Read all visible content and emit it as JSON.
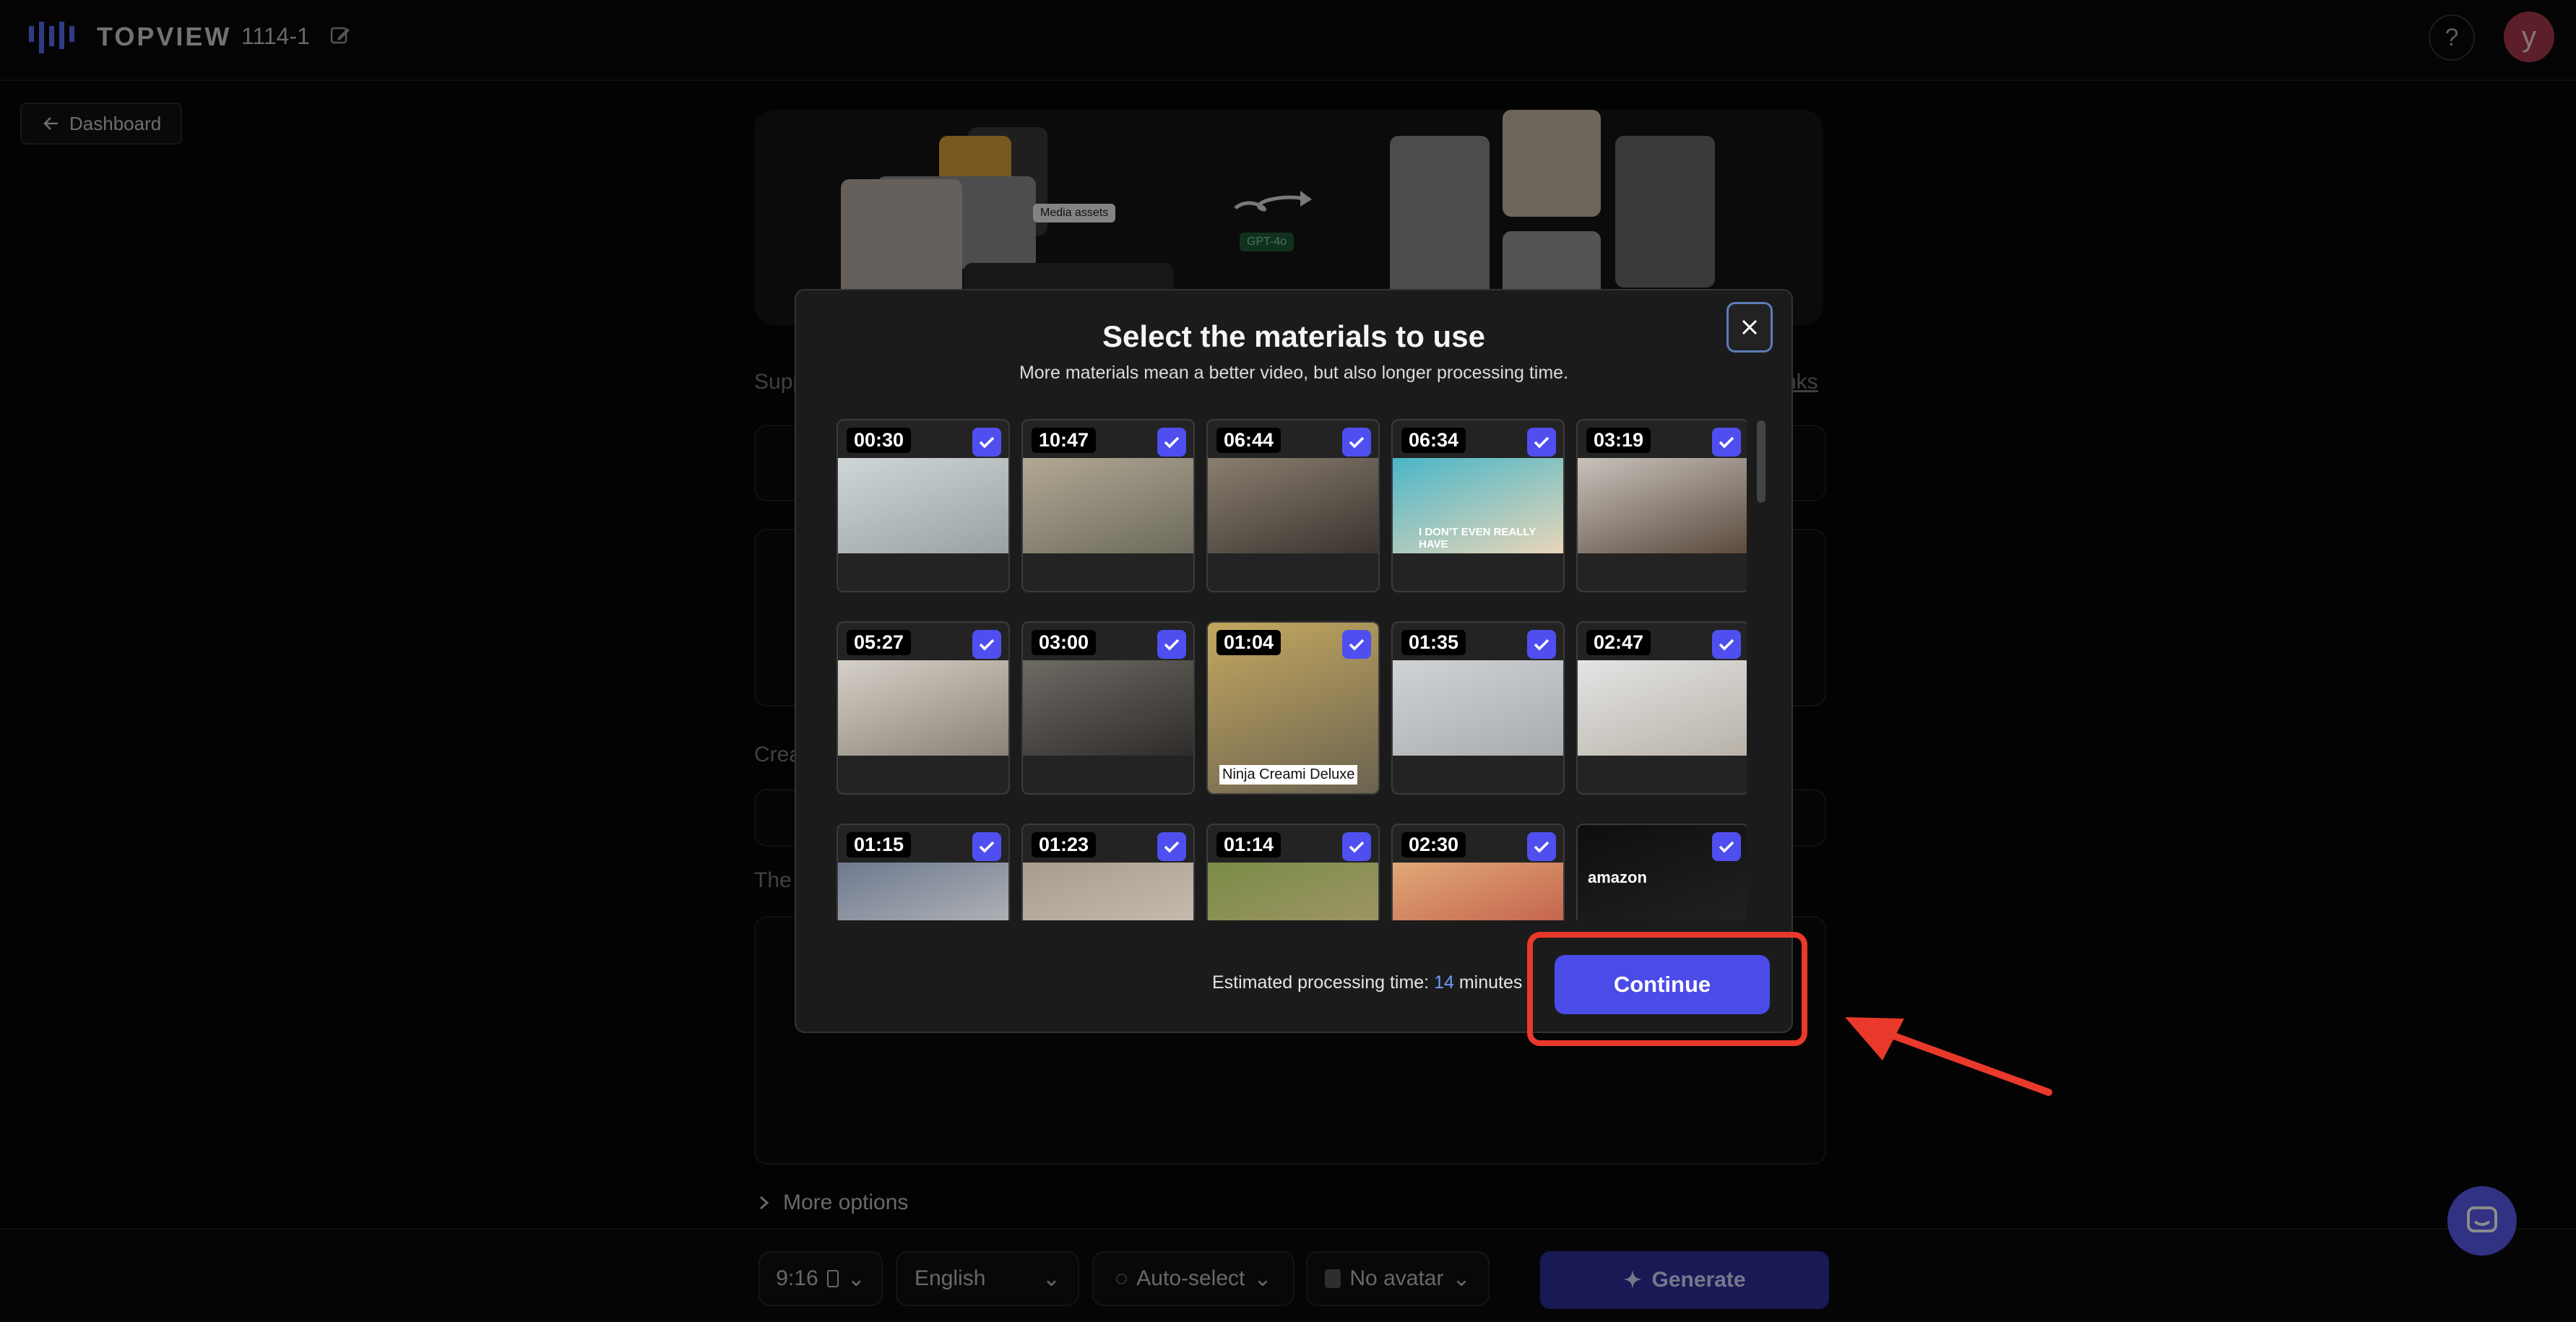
{
  "header": {
    "brand": "TOPVIEW",
    "project_name": "1114-1",
    "avatar_initial": "y",
    "help_label": "?"
  },
  "nav": {
    "back_label": "Dashboard"
  },
  "background": {
    "hero_badge": "GPT-4o",
    "hero_media_label": "Media assets",
    "section_supp": "Supp",
    "section_links": "nks",
    "section_crea": "Crea",
    "section_the": "The",
    "more_options": "More options"
  },
  "modal": {
    "title": "Select the materials to use",
    "subtitle": "More materials mean a better video, but also longer processing time.",
    "estimate_prefix": "Estimated processing time: ",
    "estimate_minutes": "14",
    "estimate_suffix": " minutes",
    "continue_label": "Continue",
    "materials": [
      {
        "duration": "00:30",
        "selected": true
      },
      {
        "duration": "10:47",
        "selected": true
      },
      {
        "duration": "06:44",
        "selected": true
      },
      {
        "duration": "06:34",
        "selected": true,
        "caption": "I DON'T EVEN REALLY HAVE"
      },
      {
        "duration": "03:19",
        "selected": true
      },
      {
        "duration": "05:27",
        "selected": true
      },
      {
        "duration": "03:00",
        "selected": true
      },
      {
        "duration": "01:04",
        "selected": true,
        "caption": "Ninja Creami Deluxe"
      },
      {
        "duration": "01:35",
        "selected": true
      },
      {
        "duration": "02:47",
        "selected": true
      },
      {
        "duration": "01:15",
        "selected": true
      },
      {
        "duration": "01:23",
        "selected": true
      },
      {
        "duration": "01:14",
        "selected": true
      },
      {
        "duration": "02:30",
        "selected": true
      },
      {
        "duration": "",
        "selected": true,
        "caption": "amazon"
      }
    ]
  },
  "bottom_bar": {
    "ratio": "9:16",
    "language": "English",
    "voice": "Auto-select",
    "avatar": "No avatar",
    "generate_label": "Generate"
  },
  "colors": {
    "accent": "#4b4be8",
    "highlight": "#e8392a"
  }
}
